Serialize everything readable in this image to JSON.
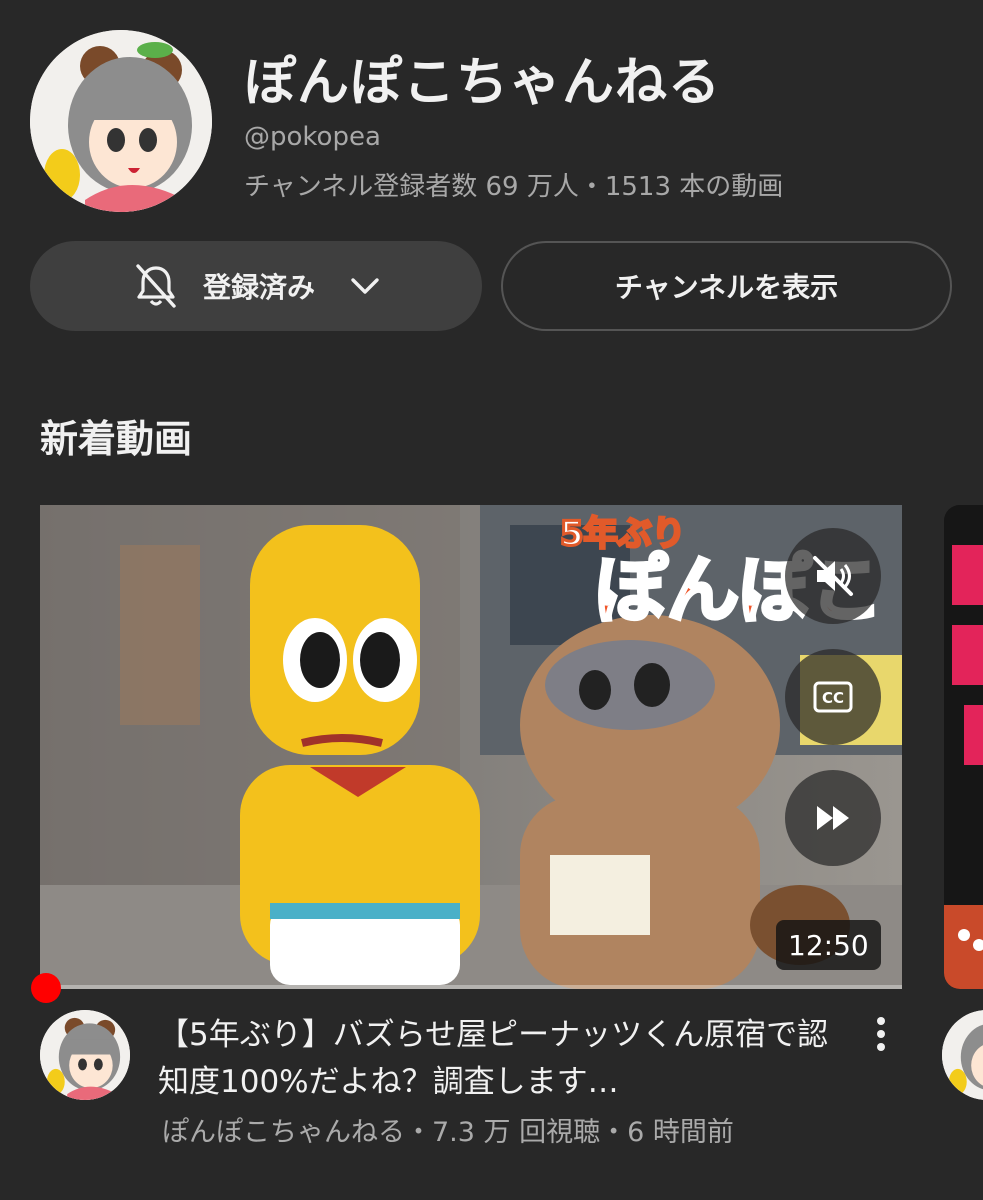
{
  "channel": {
    "name": "ぽんぽこちゃんねる",
    "handle": "@pokopea",
    "stats": "チャンネル登録者数 69 万人・1513 本の動画"
  },
  "buttons": {
    "subscribed_label": "登録済み",
    "view_channel_label": "チャンネルを表示"
  },
  "section": {
    "title": "新着動画"
  },
  "video": {
    "duration": "12:50",
    "title": "【5年ぶり】バズらせ屋ピーナッツくん原宿で認知度100%だよね？調査します…",
    "meta": "ぽんぽこちゃんねる・7.3 万 回視聴・6 時間前",
    "controls": [
      "mute-icon",
      "captions-icon",
      "fast-forward-icon"
    ],
    "overlay_text": "5年ぶり",
    "overlay_logo": "ぽんぽこ"
  },
  "colors": {
    "background": "#282828",
    "button_bg": "#3f3f3f",
    "text_primary": "#f1f1f1",
    "text_secondary": "#aaaaaa",
    "progress": "#ff0000"
  }
}
